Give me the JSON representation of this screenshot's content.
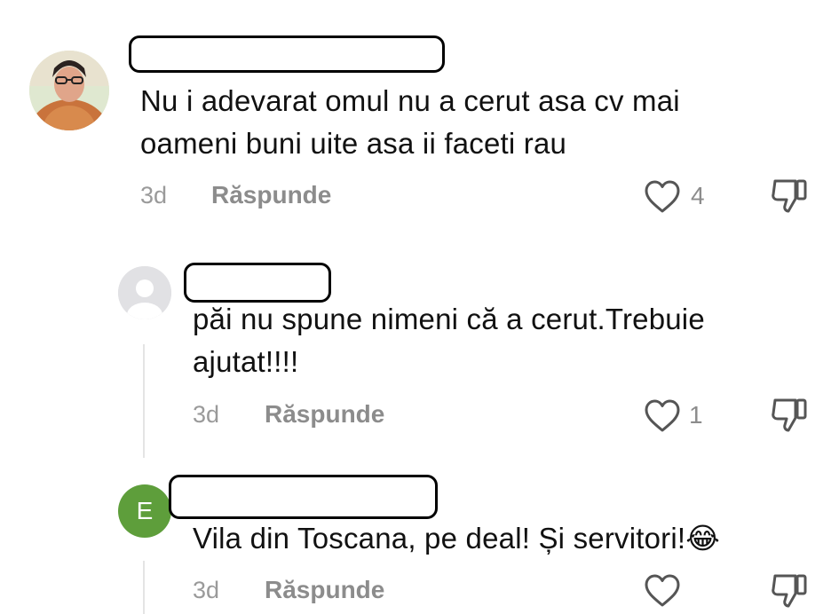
{
  "comments": [
    {
      "avatar": "user-photo",
      "text": "Nu i adevarat omul nu a cerut asa cv mai oameni buni uite asa ii faceti rau",
      "time": "3d",
      "reply_label": "Răspunde",
      "likes": "4"
    },
    {
      "avatar": "default-user",
      "text": "păi nu spune nimeni că a cerut.Trebuie ajutat!!!!",
      "time": "3d",
      "reply_label": "Răspunde",
      "likes": "1"
    },
    {
      "avatar_letter": "E",
      "text": "Vila din Toscana, pe deal! Și servitori!😂",
      "time": "3d",
      "reply_label": "Răspunde",
      "likes": ""
    }
  ],
  "colors": {
    "avatar_letter_bg": "#5e9e3b",
    "meta_text": "#8c8c8c"
  },
  "icons": {
    "like": "heart-outline-icon",
    "dislike": "thumbs-down-outline-icon"
  }
}
